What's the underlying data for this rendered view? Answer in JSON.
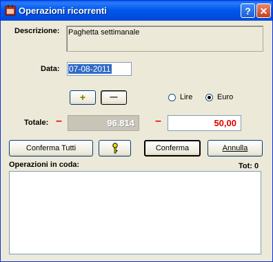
{
  "window": {
    "title": "Operazioni ricorrenti",
    "help_label": "?",
    "close_label": "✕",
    "icon": "calendar-app-icon"
  },
  "description": {
    "label": "Descrizione:",
    "value": "Paghetta settimanale"
  },
  "date": {
    "label": "Data:",
    "value": "07-08-2011"
  },
  "sign_buttons": {
    "plus": "+",
    "minus": "—"
  },
  "currency": {
    "lire_label": "Lire",
    "euro_label": "Euro",
    "selected": "Euro"
  },
  "total": {
    "label": "Totale:",
    "sign_left": "–",
    "converted_value": "96.814",
    "sign_right": "–",
    "value": "50,00"
  },
  "buttons": {
    "confirm_all": "Conferma Tutti",
    "info_icon": "key-icon",
    "confirm": "Conferma",
    "cancel": "Annulla"
  },
  "queue": {
    "label": "Operazioni in coda:",
    "count_label": "Tot: 0",
    "items": []
  },
  "colors": {
    "accent": "#0058ee",
    "negative": "#e00000",
    "selection": "#316ac5"
  }
}
